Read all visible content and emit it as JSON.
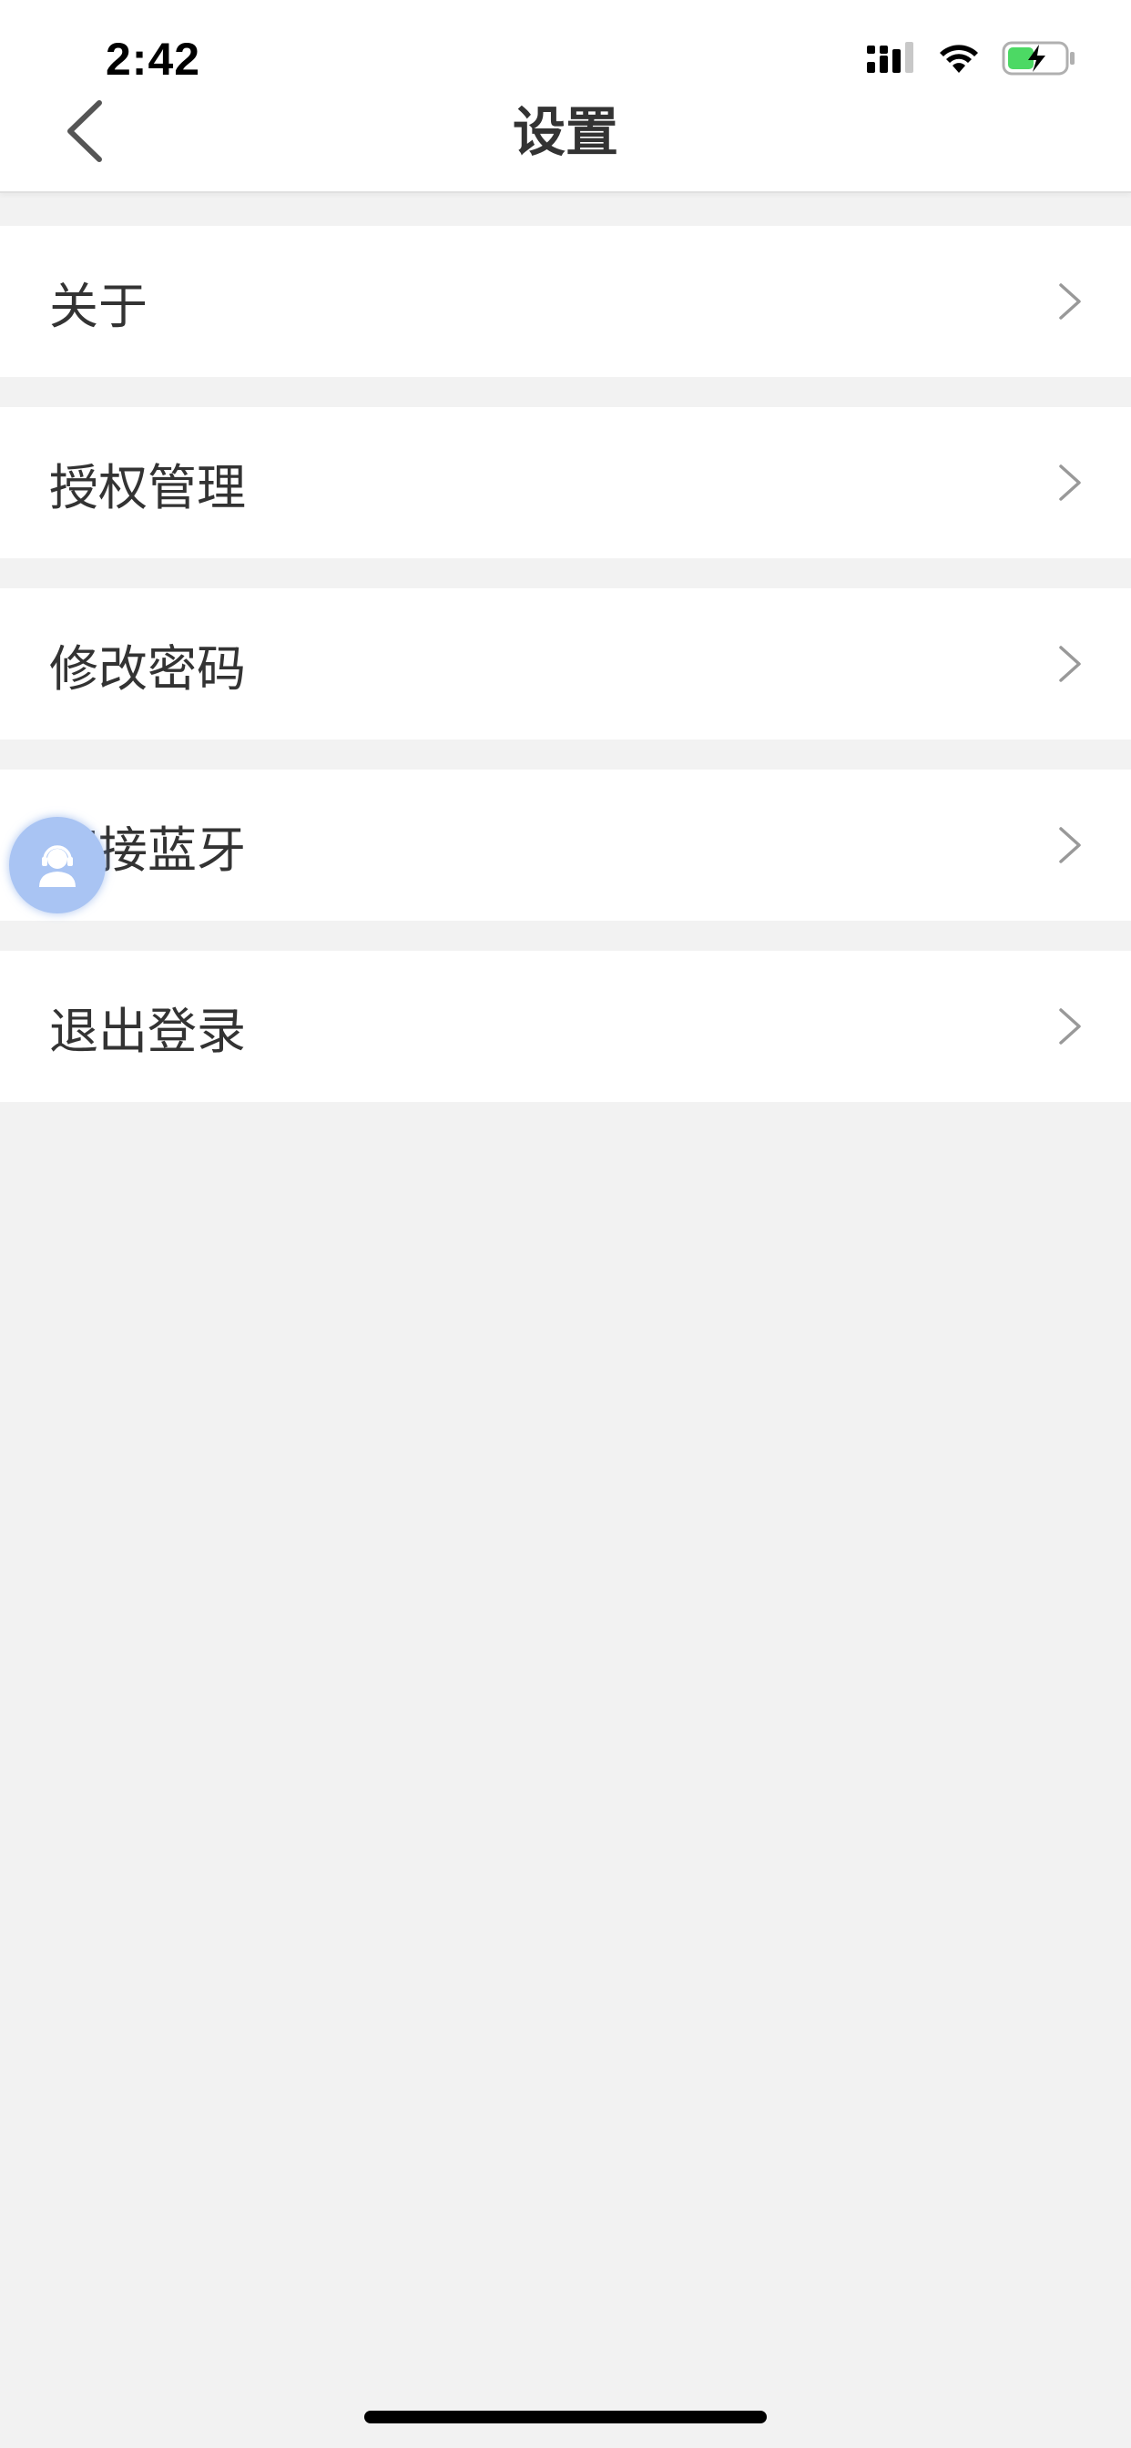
{
  "status_bar": {
    "time": "2:42"
  },
  "navbar": {
    "title": "设置",
    "back_icon": "chevron-left-icon"
  },
  "menu": {
    "items": [
      {
        "label": "关于"
      },
      {
        "label": "授权管理"
      },
      {
        "label": "修改密码"
      },
      {
        "label": "连接蓝牙"
      },
      {
        "label": "退出登录"
      }
    ]
  },
  "float_button": {
    "icon": "customer-service-icon",
    "color": "#a9c4f3"
  },
  "colors": {
    "background": "#f2f2f2",
    "card": "#ffffff",
    "text": "#333333",
    "chevron": "#999999",
    "battery_fill": "#4cd964"
  }
}
